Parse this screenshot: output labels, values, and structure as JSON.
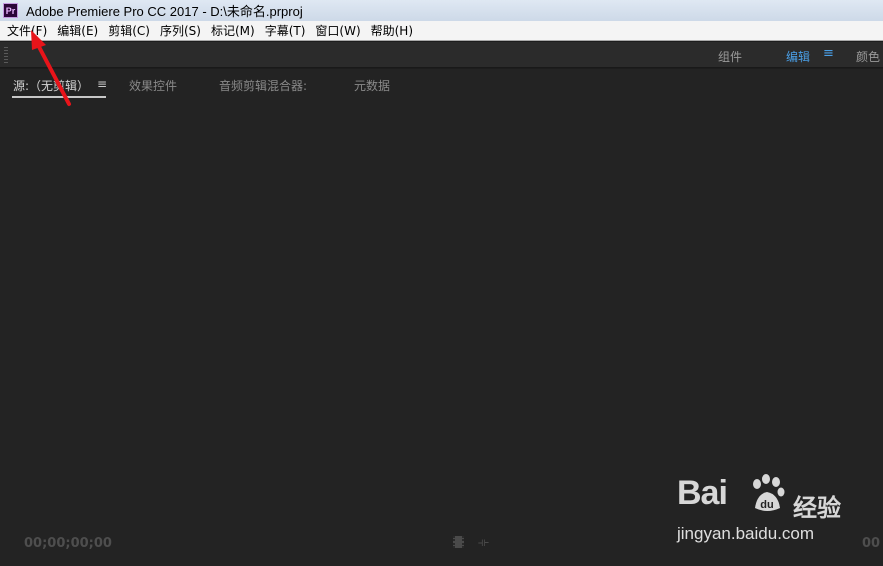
{
  "window": {
    "app_icon": "Pr",
    "title": "Adobe Premiere Pro CC 2017 - D:\\未命名.prproj"
  },
  "menu": {
    "items": [
      {
        "label": "文件(F)"
      },
      {
        "label": "编辑(E)"
      },
      {
        "label": "剪辑(C)"
      },
      {
        "label": "序列(S)"
      },
      {
        "label": "标记(M)"
      },
      {
        "label": "字幕(T)"
      },
      {
        "label": "窗口(W)"
      },
      {
        "label": "帮助(H)"
      }
    ]
  },
  "workspaces": {
    "tabs": [
      {
        "label": "组件",
        "active": false
      },
      {
        "label": "编辑",
        "active": true
      },
      {
        "label": "颜色",
        "active": false
      }
    ],
    "menu_icon": "≡"
  },
  "source_panel": {
    "tabs": [
      {
        "label": "源:（无剪辑）",
        "active": true
      },
      {
        "label": "效果控件",
        "active": false
      },
      {
        "label": "音频剪辑混合器:",
        "active": false
      },
      {
        "label": "元数据",
        "active": false
      }
    ],
    "menu_icon": "≡",
    "timecode_left": "00;00;00;00",
    "timecode_right": "00"
  },
  "watermark": {
    "logo_text": "Bai",
    "logo_du": "du",
    "chinese": "经验",
    "url": "jingyan.baidu.com"
  },
  "colors": {
    "annotation_arrow": "#e8141a",
    "active_workspace": "#4a9fe6"
  }
}
